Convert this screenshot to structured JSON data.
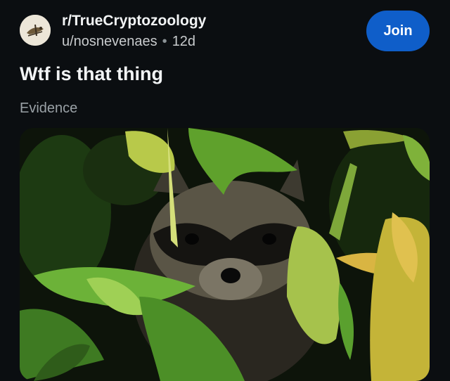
{
  "community": {
    "name": "r/TrueCryptozoology",
    "icon": "community-avatar-icon"
  },
  "post": {
    "author": "u/nosnevenaes",
    "separator": "•",
    "age": "12d",
    "title": "Wtf is that thing",
    "flair": "Evidence",
    "media_icon": "raccoon-photo"
  },
  "actions": {
    "join_label": "Join"
  },
  "colors": {
    "background": "#0b0e11",
    "join_button": "#0f5ec9",
    "text_primary": "#f2f4f5",
    "text_secondary": "#c8cbcd",
    "flair_text": "#9aa1a6"
  }
}
